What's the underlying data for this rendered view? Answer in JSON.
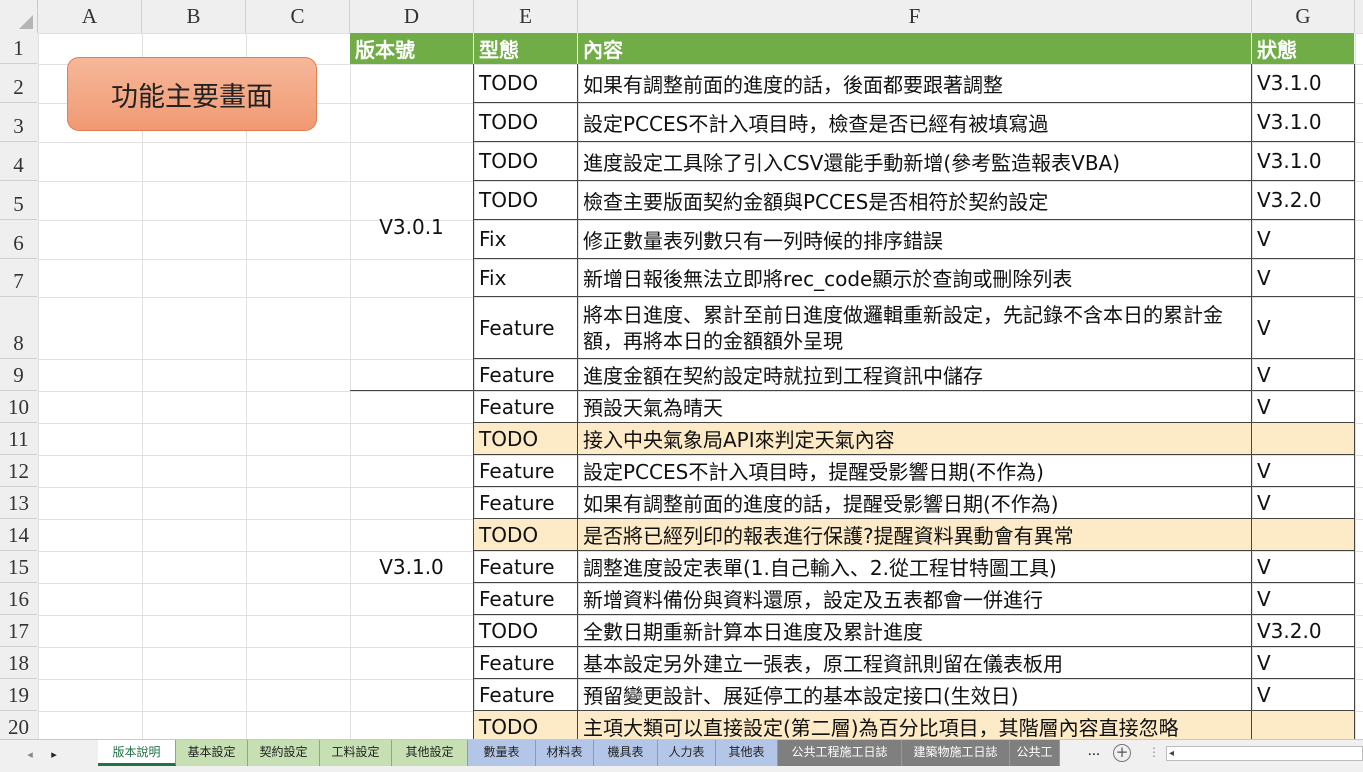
{
  "columns": [
    "A",
    "B",
    "C",
    "D",
    "E",
    "F",
    "G"
  ],
  "rows": [
    "1",
    "2",
    "3",
    "4",
    "5",
    "6",
    "7",
    "8",
    "9",
    "10",
    "11",
    "12",
    "13",
    "14",
    "15",
    "16",
    "17",
    "18",
    "19",
    "20"
  ],
  "header": {
    "version": "版本號",
    "type": "型態",
    "content": "內容",
    "status": "狀態"
  },
  "button_label": "功能主要畫面",
  "groups": [
    {
      "label": "V3.0.1"
    },
    {
      "label": "V3.1.0"
    }
  ],
  "entries": [
    {
      "type": "TODO",
      "content": "如果有調整前面的進度的話，後面都要跟著調整",
      "status": "V3.1.0",
      "highlight": false
    },
    {
      "type": "TODO",
      "content": "設定PCCES不計入項目時，檢查是否已經有被填寫過",
      "status": "V3.1.0",
      "highlight": false
    },
    {
      "type": "TODO",
      "content": "進度設定工具除了引入CSV還能手動新增(參考監造報表VBA)",
      "status": "V3.1.0",
      "highlight": false
    },
    {
      "type": "TODO",
      "content": "檢查主要版面契約金額與PCCES是否相符於契約設定",
      "status": "V3.2.0",
      "highlight": false
    },
    {
      "type": "Fix",
      "content": "修正數量表列數只有一列時候的排序錯誤",
      "status": "V",
      "highlight": false
    },
    {
      "type": "Fix",
      "content": "新增日報後無法立即將rec_code顯示於查詢或刪除列表",
      "status": "V",
      "highlight": false
    },
    {
      "type": "Feature",
      "content": "將本日進度、累計至前日進度做邏輯重新設定，先記錄不含本日的累計金額，再將本日的金額額外呈現",
      "status": "V",
      "highlight": false
    },
    {
      "type": "Feature",
      "content": "進度金額在契約設定時就拉到工程資訊中儲存",
      "status": "V",
      "highlight": false
    },
    {
      "type": "Feature",
      "content": "預設天氣為晴天",
      "status": "V",
      "highlight": false
    },
    {
      "type": "TODO",
      "content": "接入中央氣象局API來判定天氣內容",
      "status": "",
      "highlight": true
    },
    {
      "type": "Feature",
      "content": "設定PCCES不計入項目時，提醒受影響日期(不作為)",
      "status": "V",
      "highlight": false
    },
    {
      "type": "Feature",
      "content": "如果有調整前面的進度的話，提醒受影響日期(不作為)",
      "status": "V",
      "highlight": false
    },
    {
      "type": "TODO",
      "content": "是否將已經列印的報表進行保護?提醒資料異動會有異常",
      "status": "",
      "highlight": true
    },
    {
      "type": "Feature",
      "content": "調整進度設定表單(1.自己輸入、2.從工程甘特圖工具)",
      "status": "V",
      "highlight": false
    },
    {
      "type": "Feature",
      "content": "新增資料備份與資料還原，設定及五表都會一併進行",
      "status": "V",
      "highlight": false
    },
    {
      "type": "TODO",
      "content": "全數日期重新計算本日進度及累計進度",
      "status": "V3.2.0",
      "highlight": false
    },
    {
      "type": "Feature",
      "content": "基本設定另外建立一張表，原工程資訊則留在儀表板用",
      "status": "V",
      "highlight": false
    },
    {
      "type": "Feature",
      "content": "預留變更設計、展延停工的基本設定接口(生效日)",
      "status": "V",
      "highlight": false
    },
    {
      "type": "TODO",
      "content": "主項大類可以直接設定(第二層)為百分比項目，其階層內容直接忽略",
      "status": "",
      "highlight": true
    }
  ],
  "tabs": [
    {
      "label": "版本說明",
      "style": "active"
    },
    {
      "label": "基本設定",
      "style": "green"
    },
    {
      "label": "契約設定",
      "style": "green"
    },
    {
      "label": "工料設定",
      "style": "green"
    },
    {
      "label": "其他設定",
      "style": "green"
    },
    {
      "label": "數量表",
      "style": "blue"
    },
    {
      "label": "材料表",
      "style": "blue"
    },
    {
      "label": "機具表",
      "style": "blue"
    },
    {
      "label": "人力表",
      "style": "blue"
    },
    {
      "label": "其他表",
      "style": "blue"
    },
    {
      "label": "公共工程施工日誌",
      "style": "gray"
    },
    {
      "label": "建築物施工日誌",
      "style": "gray"
    },
    {
      "label": "公共工",
      "style": "gray"
    }
  ],
  "tab_more": "...",
  "add_sheet": "+",
  "nav_prev": "◂",
  "nav_next": "▸"
}
